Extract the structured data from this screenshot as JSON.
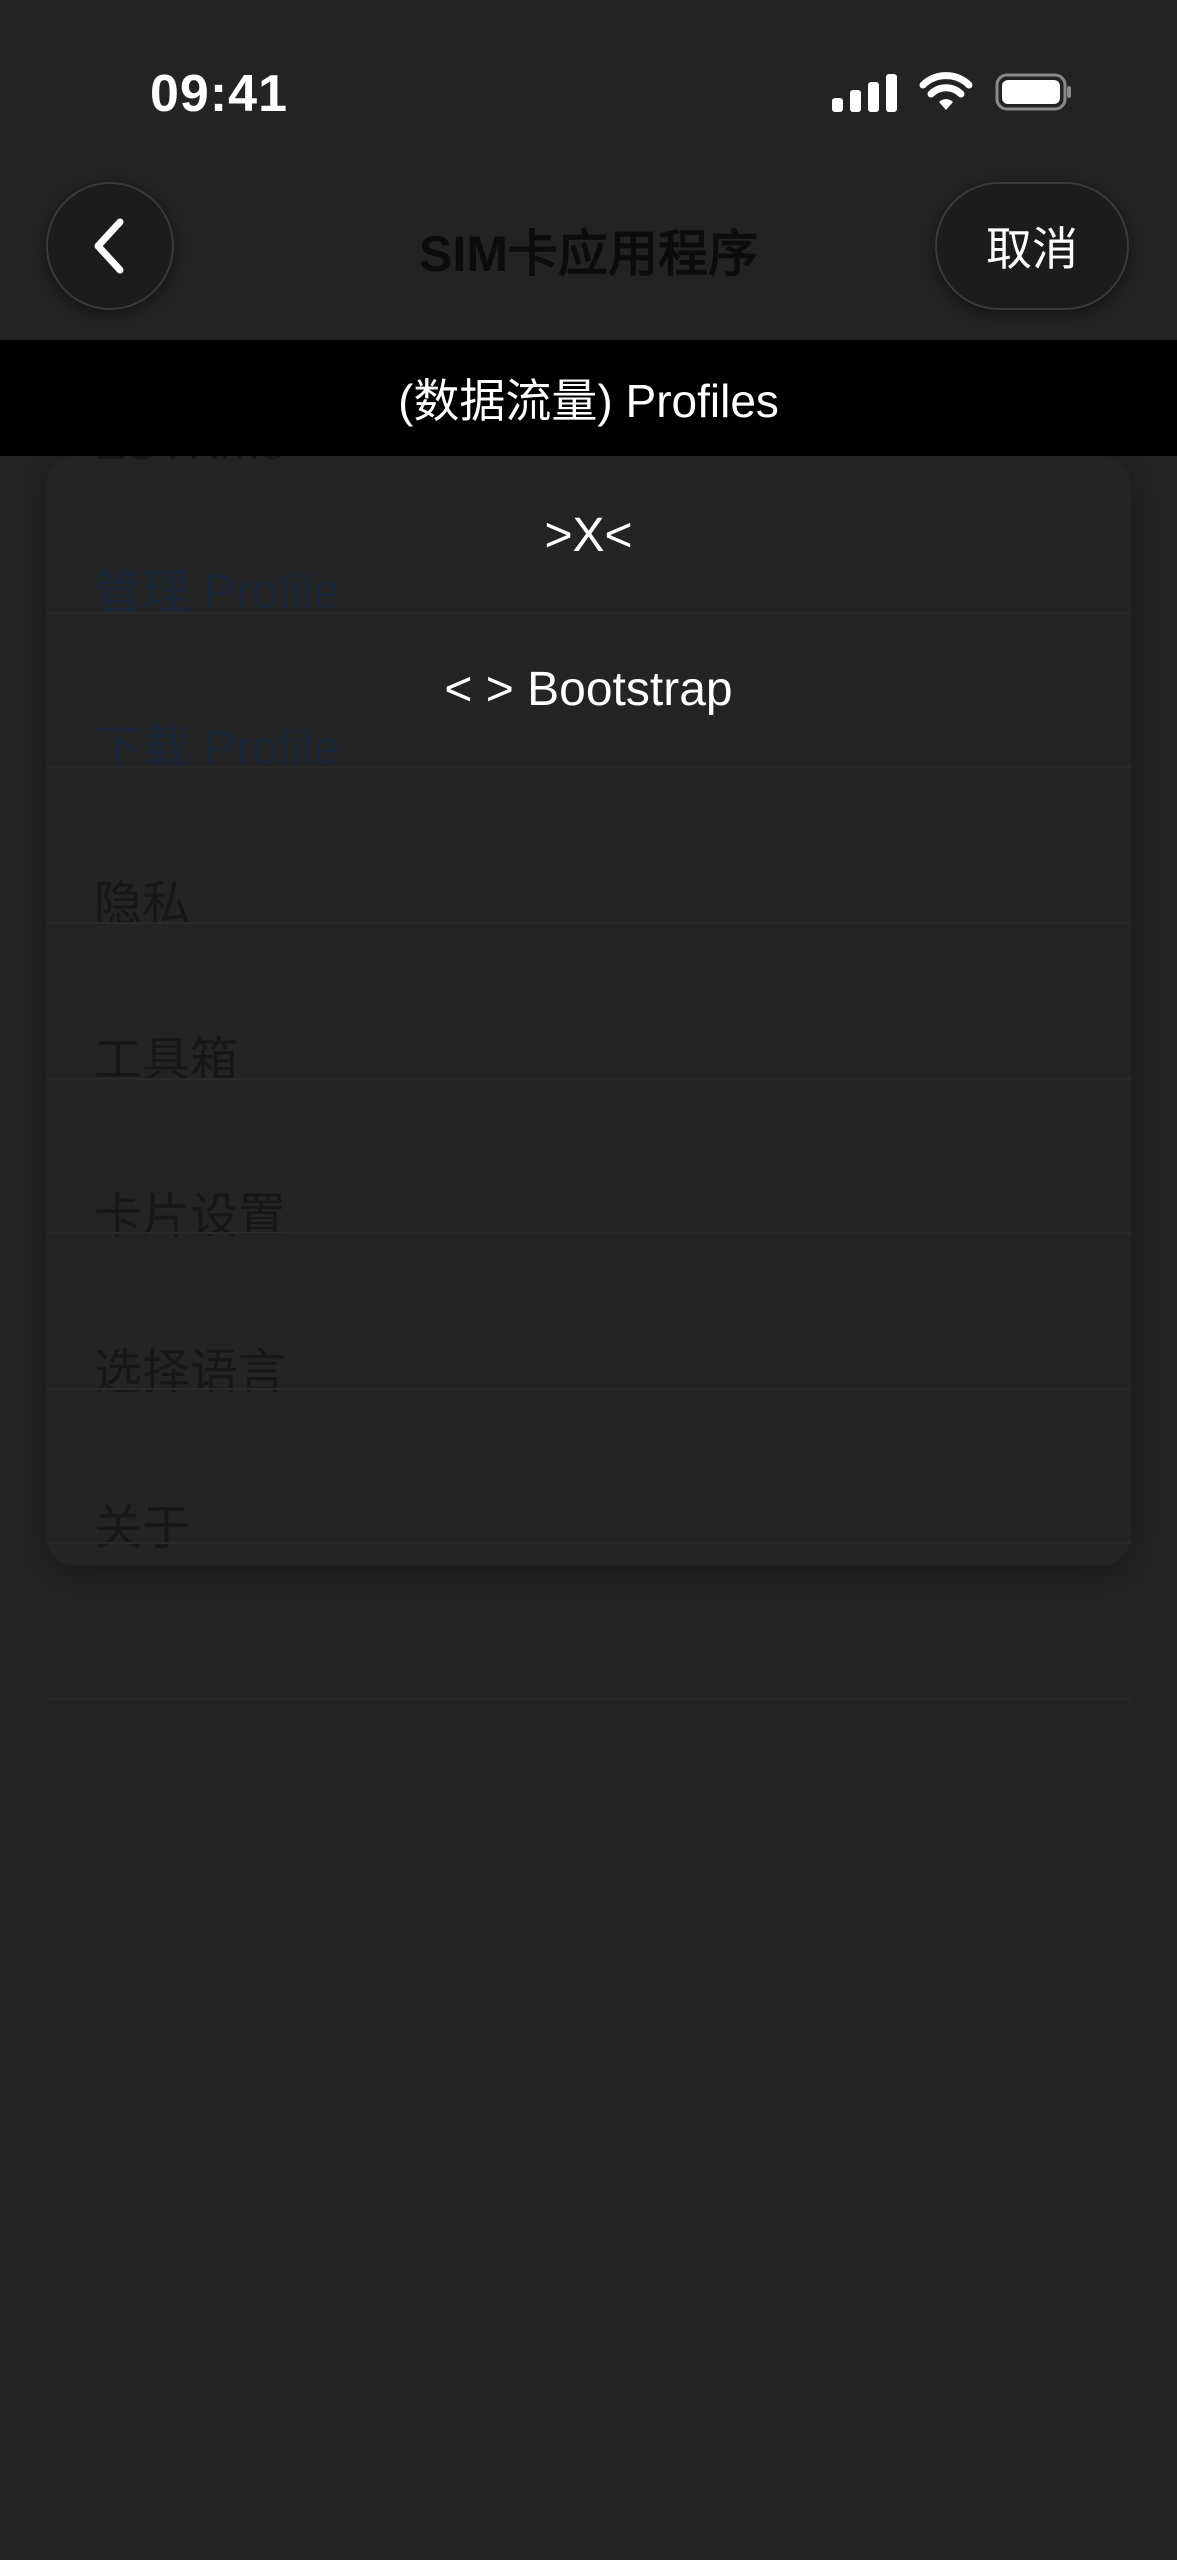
{
  "status_bar": {
    "time": "09:41",
    "icons": [
      "cellular-signal-icon",
      "wifi-icon",
      "battery-icon"
    ]
  },
  "nav": {
    "back_icon": "chevron-left-icon",
    "title": "SIM卡应用程序",
    "cancel_label": "取消"
  },
  "banner": {
    "text": "(数据流量) Profiles"
  },
  "list": {
    "section_label": "ESTKme",
    "items": [
      {
        "label": "管理 Profile"
      },
      {
        "label": "下载 Profile"
      },
      {
        "label": "隐私"
      },
      {
        "label": "工具箱"
      },
      {
        "label": "卡片设置"
      },
      {
        "label": "选择语言"
      },
      {
        "label": "关于"
      }
    ]
  },
  "overlay": {
    "options": [
      {
        "label": ">X<"
      },
      {
        "label": "< > Bootstrap"
      }
    ]
  },
  "colors": {
    "background": "#232323",
    "banner_background": "#000000",
    "overlay_text": "#ffffff",
    "dimmed_link_text": "#1b2636"
  }
}
